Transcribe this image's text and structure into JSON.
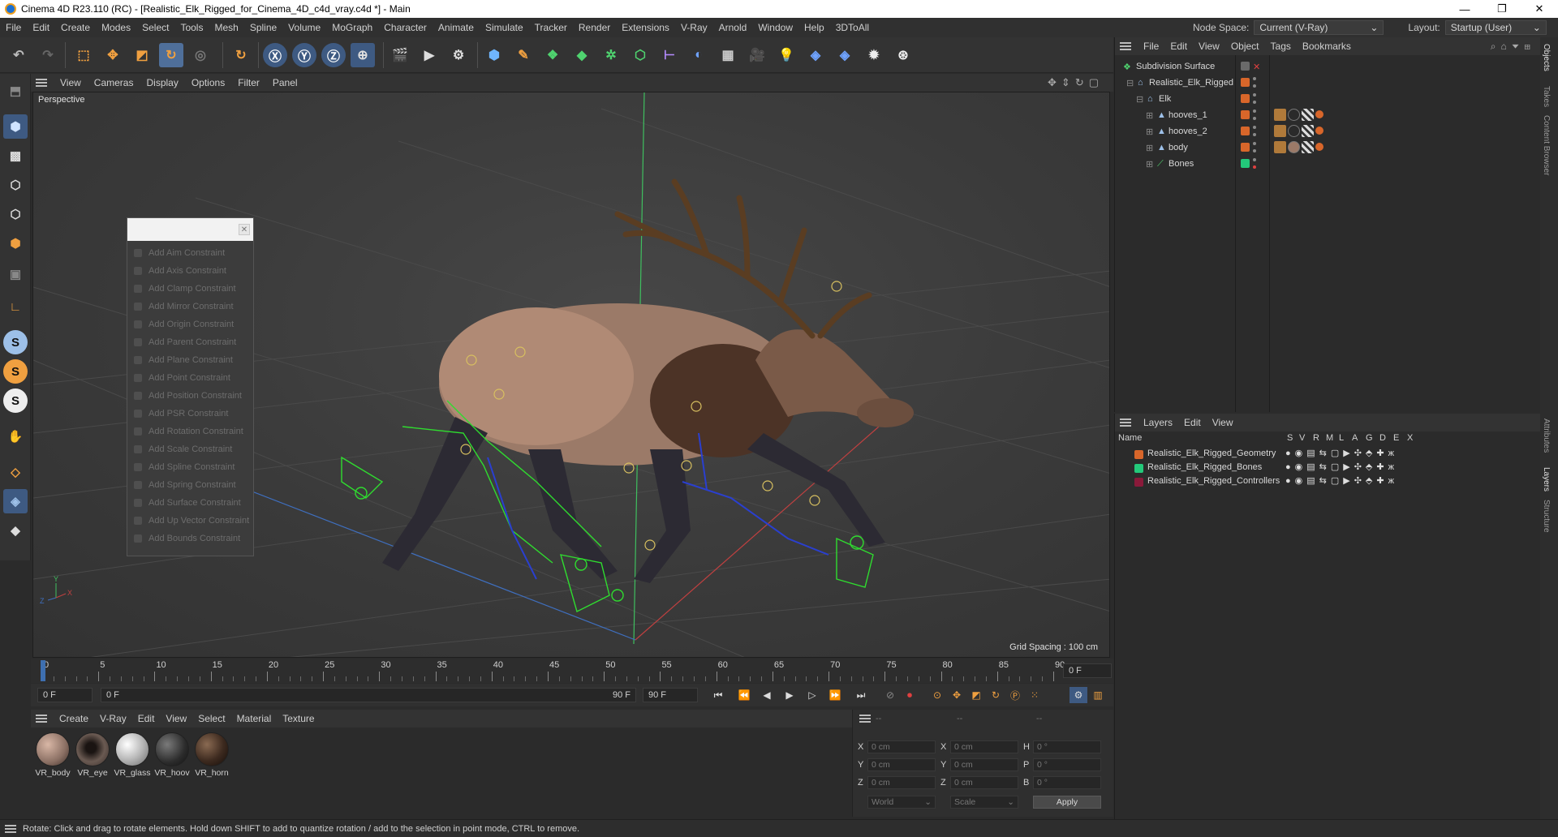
{
  "window": {
    "title": "Cinema 4D R23.110 (RC) - [Realistic_Elk_Rigged_for_Cinema_4D_c4d_vray.c4d *] - Main",
    "controls": [
      "—",
      "❐",
      "✕"
    ]
  },
  "menubar": {
    "items": [
      "File",
      "Edit",
      "Create",
      "Modes",
      "Select",
      "Tools",
      "Mesh",
      "Spline",
      "Volume",
      "MoGraph",
      "Character",
      "Animate",
      "Simulate",
      "Tracker",
      "Render",
      "Extensions",
      "V-Ray",
      "Arnold",
      "Window",
      "Help",
      "3DToAll"
    ],
    "node_space_label": "Node Space:",
    "node_space_value": "Current (V-Ray)",
    "layout_label": "Layout:",
    "layout_value": "Startup (User)"
  },
  "viewport": {
    "menu": [
      "Cameras",
      "Display",
      "Options",
      "Filter",
      "Panel"
    ],
    "view_label": "View",
    "camera_label": "Perspective",
    "grid_spacing": "Grid Spacing : 100 cm"
  },
  "constraint_popup": {
    "items": [
      "Add Aim Constraint",
      "Add Axis Constraint",
      "Add Clamp Constraint",
      "Add Mirror Constraint",
      "Add Origin Constraint",
      "Add Parent Constraint",
      "Add Plane Constraint",
      "Add Point Constraint",
      "Add Position Constraint",
      "Add PSR Constraint",
      "Add Rotation Constraint",
      "Add Scale Constraint",
      "Add Spline Constraint",
      "Add Spring Constraint",
      "Add Surface Constraint",
      "Add Up Vector Constraint",
      "Add Bounds Constraint"
    ]
  },
  "timeline": {
    "ticks": [
      "0",
      "5",
      "10",
      "15",
      "20",
      "25",
      "30",
      "35",
      "40",
      "45",
      "50",
      "55",
      "60",
      "65",
      "70",
      "75",
      "80",
      "85",
      "90"
    ],
    "current_frame_field": "0 F",
    "start_field": "0 F",
    "range_start": "0 F",
    "range_end": "90 F",
    "end_field": "90 F"
  },
  "material_manager": {
    "menu": [
      "Create",
      "V-Ray",
      "Edit",
      "View",
      "Select",
      "Material",
      "Texture"
    ],
    "materials": [
      {
        "name": "VR_body",
        "color": "#8a6f63"
      },
      {
        "name": "VR_eye",
        "color": "#3a2e2a"
      },
      {
        "name": "VR_glass",
        "color": "#b9b9b9"
      },
      {
        "name": "VR_hoov",
        "color": "#2c2c2c"
      },
      {
        "name": "VR_horn",
        "color": "#3d2a1f"
      }
    ]
  },
  "coordinates": {
    "header": [
      "--",
      "--",
      "--"
    ],
    "rows": [
      {
        "axis": "X",
        "pos": "0 cm",
        "axis2": "X",
        "size": "0 cm",
        "rot_label": "H",
        "rot": "0 °"
      },
      {
        "axis": "Y",
        "pos": "0 cm",
        "axis2": "Y",
        "size": "0 cm",
        "rot_label": "P",
        "rot": "0 °"
      },
      {
        "axis": "Z",
        "pos": "0 cm",
        "axis2": "Z",
        "size": "0 cm",
        "rot_label": "B",
        "rot": "0 °"
      }
    ],
    "mode_world": "World",
    "mode_scale": "Scale",
    "apply_label": "Apply"
  },
  "status": {
    "text": "Rotate: Click and drag to rotate elements. Hold down SHIFT to add to quantize rotation / add to the selection in point mode, CTRL to remove."
  },
  "object_manager": {
    "menu": [
      "File",
      "Edit",
      "View",
      "Object",
      "Tags",
      "Bookmarks"
    ],
    "objects": [
      {
        "name": "Subdivision Surface",
        "color": "#7a7a7a"
      },
      {
        "name": "Realistic_Elk_Rigged",
        "color": "#d8662a"
      },
      {
        "name": "Elk",
        "color": "#d8662a"
      },
      {
        "name": "hooves_1",
        "color": "#d8662a"
      },
      {
        "name": "hooves_2",
        "color": "#d8662a"
      },
      {
        "name": "body",
        "color": "#d8662a"
      },
      {
        "name": "Bones",
        "color": "#23c97a"
      }
    ]
  },
  "layer_manager": {
    "menu": [
      "Layers",
      "Edit",
      "View"
    ],
    "columns": [
      "Name",
      "S",
      "V",
      "R",
      "M",
      "L",
      "A",
      "G",
      "D",
      "E",
      "X"
    ],
    "layers": [
      {
        "name": "Realistic_Elk_Rigged_Geometry",
        "color": "#d8662a"
      },
      {
        "name": "Realistic_Elk_Rigged_Bones",
        "color": "#23c97a"
      },
      {
        "name": "Realistic_Elk_Rigged_Controllers",
        "color": "#8a1a3a"
      }
    ]
  },
  "side_tabs": [
    "Objects",
    "Takes",
    "Content Browser",
    "Attributes",
    "Layers",
    "Structure"
  ]
}
